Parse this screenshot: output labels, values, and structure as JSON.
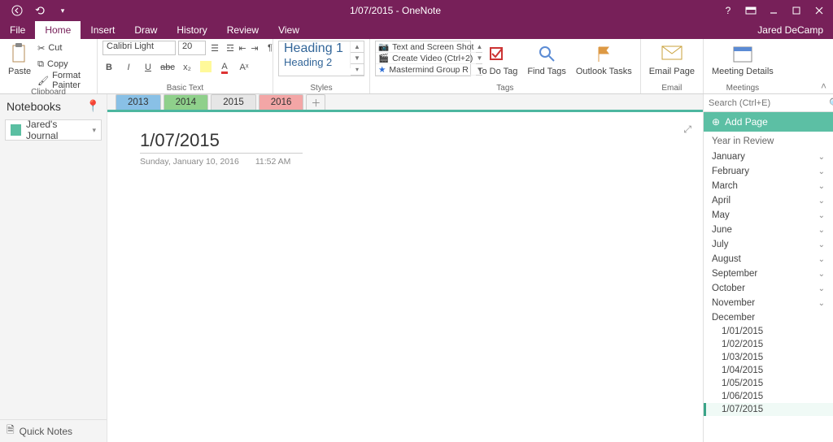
{
  "window": {
    "title": "1/07/2015 - OneNote",
    "user": "Jared DeCamp"
  },
  "tabs": {
    "file": "File",
    "home": "Home",
    "insert": "Insert",
    "draw": "Draw",
    "history": "History",
    "review": "Review",
    "view": "View"
  },
  "clipboard": {
    "paste": "Paste",
    "cut": "Cut",
    "copy": "Copy",
    "format_painter": "Format Painter",
    "label": "Clipboard"
  },
  "font": {
    "name": "Calibri Light",
    "size": "20",
    "label": "Basic Text"
  },
  "styles": {
    "h1": "Heading 1",
    "h2": "Heading 2",
    "label": "Styles"
  },
  "tags": {
    "items": [
      "Text and Screen Shot",
      "Create Video (Ctrl+2)",
      "Mastermind Group R"
    ],
    "todo": "To Do Tag",
    "find": "Find Tags",
    "outlook": "Outlook Tasks",
    "label": "Tags"
  },
  "email": {
    "btn": "Email Page",
    "label": "Email"
  },
  "meetings": {
    "btn": "Meeting Details",
    "label": "Meetings"
  },
  "nb": {
    "head": "Notebooks",
    "name": "Jared's Journal",
    "quick": "Quick Notes"
  },
  "sections": {
    "s2013": "2013",
    "s2014": "2014",
    "s2015": "2015",
    "s2016": "2016"
  },
  "page": {
    "title": "1/07/2015",
    "date": "Sunday, January 10, 2016",
    "time": "11:52 AM"
  },
  "search": {
    "placeholder": "Search (Ctrl+E)"
  },
  "addpage": "Add Page",
  "tree": {
    "head": "Year in Review",
    "months": [
      "January",
      "February",
      "March",
      "April",
      "May",
      "June",
      "July",
      "August",
      "September",
      "October",
      "November"
    ],
    "open_month": "December",
    "leaves": [
      "1/01/2015",
      "1/02/2015",
      "1/03/2015",
      "1/04/2015",
      "1/05/2015",
      "1/06/2015",
      "1/07/2015"
    ],
    "selected": "1/07/2015"
  }
}
